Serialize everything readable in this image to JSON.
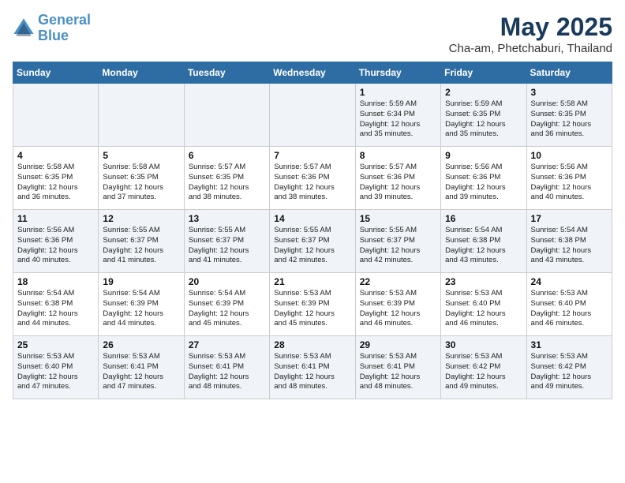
{
  "header": {
    "logo_line1": "General",
    "logo_line2": "Blue",
    "month": "May 2025",
    "location": "Cha-am, Phetchaburi, Thailand"
  },
  "weekdays": [
    "Sunday",
    "Monday",
    "Tuesday",
    "Wednesday",
    "Thursday",
    "Friday",
    "Saturday"
  ],
  "weeks": [
    [
      {
        "day": "",
        "content": ""
      },
      {
        "day": "",
        "content": ""
      },
      {
        "day": "",
        "content": ""
      },
      {
        "day": "",
        "content": ""
      },
      {
        "day": "1",
        "content": "Sunrise: 5:59 AM\nSunset: 6:34 PM\nDaylight: 12 hours\nand 35 minutes."
      },
      {
        "day": "2",
        "content": "Sunrise: 5:59 AM\nSunset: 6:35 PM\nDaylight: 12 hours\nand 35 minutes."
      },
      {
        "day": "3",
        "content": "Sunrise: 5:58 AM\nSunset: 6:35 PM\nDaylight: 12 hours\nand 36 minutes."
      }
    ],
    [
      {
        "day": "4",
        "content": "Sunrise: 5:58 AM\nSunset: 6:35 PM\nDaylight: 12 hours\nand 36 minutes."
      },
      {
        "day": "5",
        "content": "Sunrise: 5:58 AM\nSunset: 6:35 PM\nDaylight: 12 hours\nand 37 minutes."
      },
      {
        "day": "6",
        "content": "Sunrise: 5:57 AM\nSunset: 6:35 PM\nDaylight: 12 hours\nand 38 minutes."
      },
      {
        "day": "7",
        "content": "Sunrise: 5:57 AM\nSunset: 6:36 PM\nDaylight: 12 hours\nand 38 minutes."
      },
      {
        "day": "8",
        "content": "Sunrise: 5:57 AM\nSunset: 6:36 PM\nDaylight: 12 hours\nand 39 minutes."
      },
      {
        "day": "9",
        "content": "Sunrise: 5:56 AM\nSunset: 6:36 PM\nDaylight: 12 hours\nand 39 minutes."
      },
      {
        "day": "10",
        "content": "Sunrise: 5:56 AM\nSunset: 6:36 PM\nDaylight: 12 hours\nand 40 minutes."
      }
    ],
    [
      {
        "day": "11",
        "content": "Sunrise: 5:56 AM\nSunset: 6:36 PM\nDaylight: 12 hours\nand 40 minutes."
      },
      {
        "day": "12",
        "content": "Sunrise: 5:55 AM\nSunset: 6:37 PM\nDaylight: 12 hours\nand 41 minutes."
      },
      {
        "day": "13",
        "content": "Sunrise: 5:55 AM\nSunset: 6:37 PM\nDaylight: 12 hours\nand 41 minutes."
      },
      {
        "day": "14",
        "content": "Sunrise: 5:55 AM\nSunset: 6:37 PM\nDaylight: 12 hours\nand 42 minutes."
      },
      {
        "day": "15",
        "content": "Sunrise: 5:55 AM\nSunset: 6:37 PM\nDaylight: 12 hours\nand 42 minutes."
      },
      {
        "day": "16",
        "content": "Sunrise: 5:54 AM\nSunset: 6:38 PM\nDaylight: 12 hours\nand 43 minutes."
      },
      {
        "day": "17",
        "content": "Sunrise: 5:54 AM\nSunset: 6:38 PM\nDaylight: 12 hours\nand 43 minutes."
      }
    ],
    [
      {
        "day": "18",
        "content": "Sunrise: 5:54 AM\nSunset: 6:38 PM\nDaylight: 12 hours\nand 44 minutes."
      },
      {
        "day": "19",
        "content": "Sunrise: 5:54 AM\nSunset: 6:39 PM\nDaylight: 12 hours\nand 44 minutes."
      },
      {
        "day": "20",
        "content": "Sunrise: 5:54 AM\nSunset: 6:39 PM\nDaylight: 12 hours\nand 45 minutes."
      },
      {
        "day": "21",
        "content": "Sunrise: 5:53 AM\nSunset: 6:39 PM\nDaylight: 12 hours\nand 45 minutes."
      },
      {
        "day": "22",
        "content": "Sunrise: 5:53 AM\nSunset: 6:39 PM\nDaylight: 12 hours\nand 46 minutes."
      },
      {
        "day": "23",
        "content": "Sunrise: 5:53 AM\nSunset: 6:40 PM\nDaylight: 12 hours\nand 46 minutes."
      },
      {
        "day": "24",
        "content": "Sunrise: 5:53 AM\nSunset: 6:40 PM\nDaylight: 12 hours\nand 46 minutes."
      }
    ],
    [
      {
        "day": "25",
        "content": "Sunrise: 5:53 AM\nSunset: 6:40 PM\nDaylight: 12 hours\nand 47 minutes."
      },
      {
        "day": "26",
        "content": "Sunrise: 5:53 AM\nSunset: 6:41 PM\nDaylight: 12 hours\nand 47 minutes."
      },
      {
        "day": "27",
        "content": "Sunrise: 5:53 AM\nSunset: 6:41 PM\nDaylight: 12 hours\nand 48 minutes."
      },
      {
        "day": "28",
        "content": "Sunrise: 5:53 AM\nSunset: 6:41 PM\nDaylight: 12 hours\nand 48 minutes."
      },
      {
        "day": "29",
        "content": "Sunrise: 5:53 AM\nSunset: 6:41 PM\nDaylight: 12 hours\nand 48 minutes."
      },
      {
        "day": "30",
        "content": "Sunrise: 5:53 AM\nSunset: 6:42 PM\nDaylight: 12 hours\nand 49 minutes."
      },
      {
        "day": "31",
        "content": "Sunrise: 5:53 AM\nSunset: 6:42 PM\nDaylight: 12 hours\nand 49 minutes."
      }
    ]
  ]
}
